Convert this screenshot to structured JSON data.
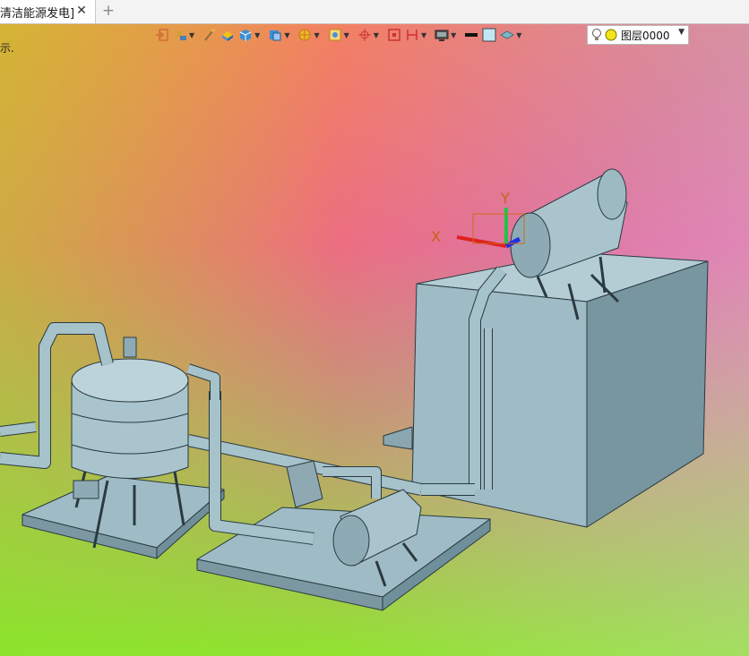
{
  "tab": {
    "label": "清洁能源发电]",
    "close_glyph": "✕",
    "add_glyph": "+"
  },
  "hint_text": "示.",
  "toolbar": {
    "icons": [
      "exit-icon",
      "paint-icon",
      "brush-icon",
      "shaded-box-icon",
      "cube-icon",
      "view-cube-icon",
      "render-icon",
      "box-select-icon",
      "axis-icon",
      "frame-icon",
      "section-icon",
      "display-icon",
      "line-color-icon",
      "fill-color-icon",
      "layer-shape-icon"
    ]
  },
  "layer": {
    "name": "图层0000",
    "caret": "▼"
  },
  "axes": {
    "x_label": "X",
    "y_label": "Y"
  },
  "colors": {
    "model": "#9fbcc6",
    "model_dark": "#6f8f9a",
    "edge": "#222"
  }
}
